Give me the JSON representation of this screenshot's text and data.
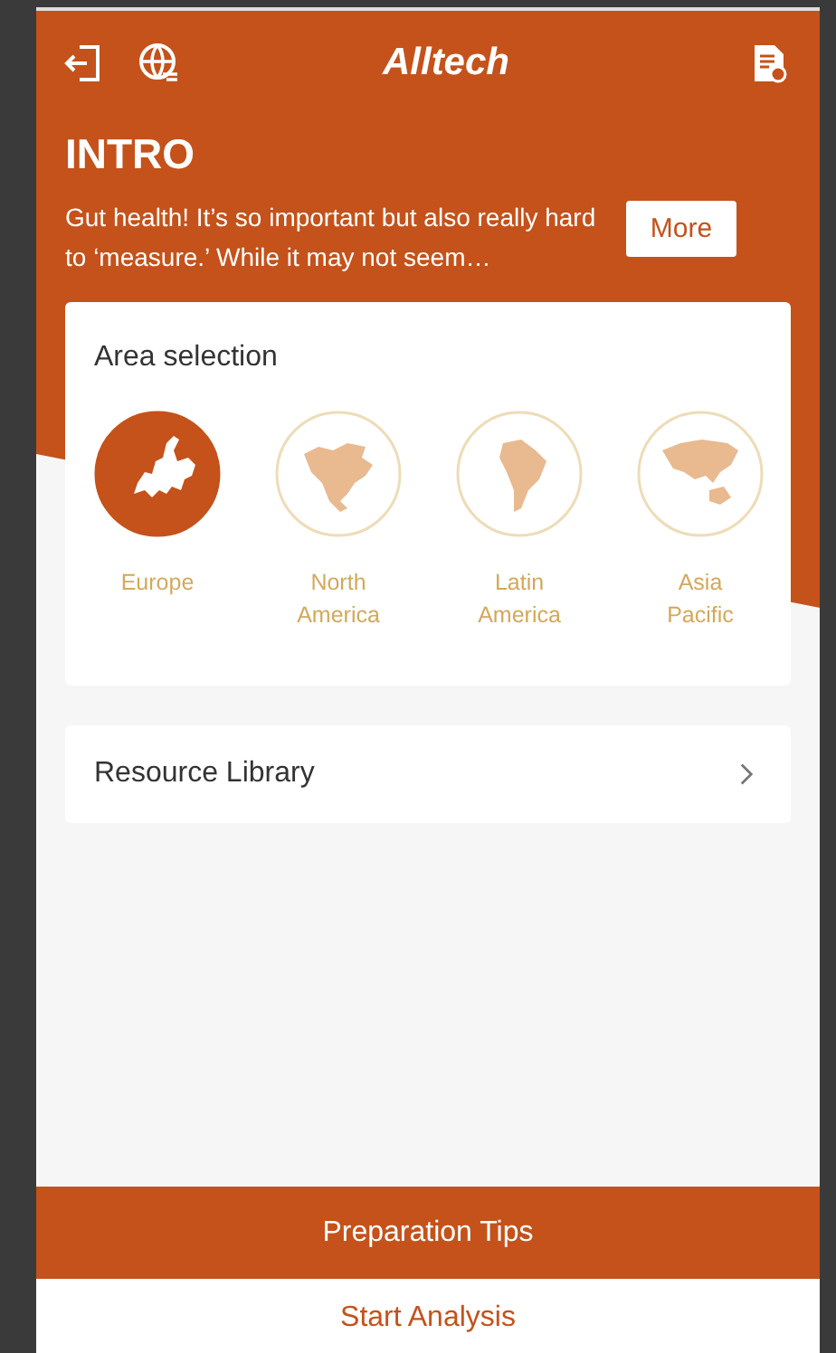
{
  "header": {
    "logo": "Alltech",
    "title": "INTRO",
    "description": "Gut health! It’s so important but also really hard to ‘measure.’ While it may not seem…",
    "more_button": "More"
  },
  "area_selection": {
    "title": "Area selection",
    "areas": [
      {
        "kind": "europe",
        "label": "Europe",
        "selected": true
      },
      {
        "kind": "north_america",
        "label": "North America",
        "selected": false
      },
      {
        "kind": "latin_america",
        "label": "Latin America",
        "selected": false
      },
      {
        "kind": "asia_pacific",
        "label": "Asia Pacific",
        "selected": false
      }
    ]
  },
  "resource_library": {
    "label": "Resource Library"
  },
  "buttons": [
    {
      "kind": "primary",
      "label": "Preparation Tips"
    },
    {
      "kind": "secondary",
      "label": "Start Analysis"
    }
  ]
}
